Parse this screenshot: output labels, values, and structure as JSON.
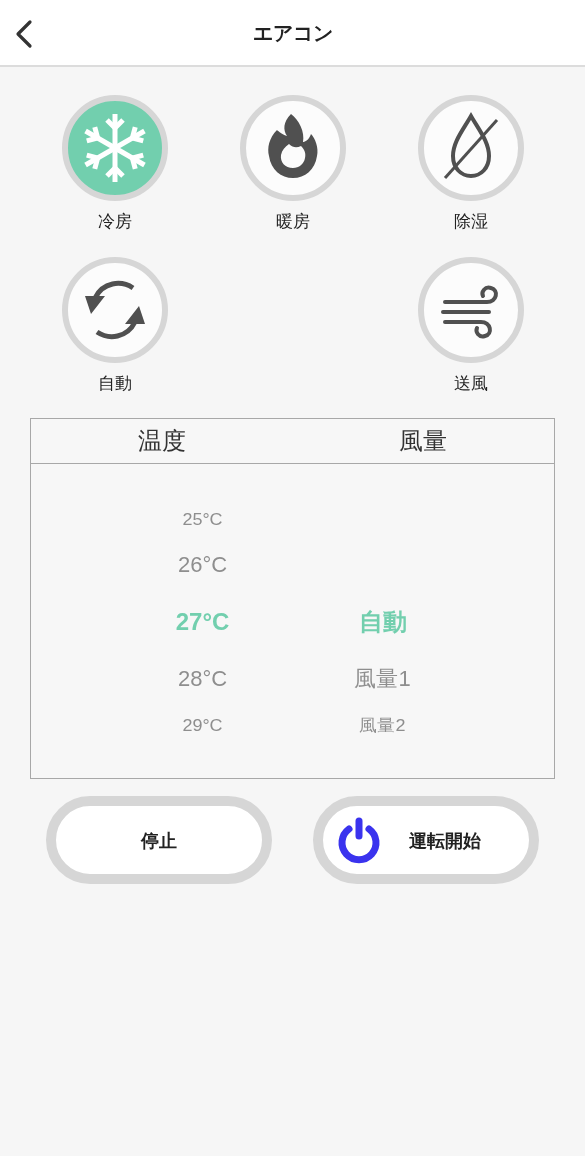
{
  "header": {
    "title": "エアコン"
  },
  "mode_rows": [
    [
      {
        "label": "冷房",
        "kind": "cool",
        "selected": true
      },
      {
        "label": "暖房",
        "kind": "heat",
        "selected": false
      },
      {
        "label": "除湿",
        "kind": "dry",
        "selected": false
      }
    ],
    [
      {
        "label": "自動",
        "kind": "auto",
        "selected": false
      },
      {
        "label": "送風",
        "kind": "fan",
        "selected": false
      }
    ]
  ],
  "picker": {
    "columns": [
      {
        "title": "温度",
        "options": [
          {
            "label": "25°C",
            "selected": false
          },
          {
            "label": "26°C",
            "selected": false
          },
          {
            "label": "27°C",
            "selected": true
          },
          {
            "label": "28°C",
            "selected": false
          },
          {
            "label": "29°C",
            "selected": false
          }
        ]
      },
      {
        "title": "風量",
        "options": [
          {
            "label": "自動",
            "selected": true
          },
          {
            "label": "風量1",
            "selected": false
          },
          {
            "label": "風量2",
            "selected": false
          }
        ]
      }
    ]
  },
  "buttons": [
    {
      "label": "停止",
      "kind": "stop"
    },
    {
      "label": "運転開始",
      "kind": "start"
    }
  ]
}
